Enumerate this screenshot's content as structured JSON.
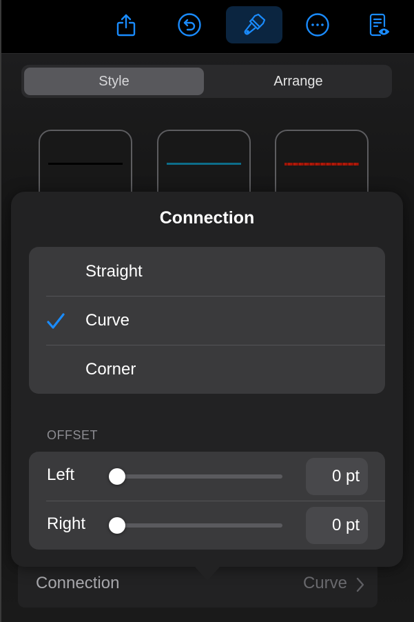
{
  "toolbar": {
    "buttons": [
      {
        "name": "share",
        "icon": "share-icon",
        "active": false
      },
      {
        "name": "undo",
        "icon": "undo-icon",
        "active": false
      },
      {
        "name": "format",
        "icon": "paintbrush-icon",
        "active": true
      },
      {
        "name": "more",
        "icon": "more-icon",
        "active": false
      },
      {
        "name": "reading-view",
        "icon": "document-eye-icon",
        "active": false
      }
    ],
    "accent_color": "#1a8cff"
  },
  "segmented": {
    "tabs": [
      {
        "label": "Style",
        "selected": true
      },
      {
        "label": "Arrange",
        "selected": false
      }
    ]
  },
  "line_styles": [
    {
      "name": "black-line",
      "color": "#000000"
    },
    {
      "name": "teal-line",
      "color": "#0d6d8a"
    },
    {
      "name": "red-textured-line",
      "color": "#a01508"
    }
  ],
  "popover": {
    "title": "Connection",
    "options": [
      {
        "label": "Straight",
        "selected": false
      },
      {
        "label": "Curve",
        "selected": true
      },
      {
        "label": "Corner",
        "selected": false
      }
    ],
    "offset_section_label": "OFFSET",
    "offsets": [
      {
        "label": "Left",
        "value": "0 pt",
        "slider_fraction": 0
      },
      {
        "label": "Right",
        "value": "0 pt",
        "slider_fraction": 0
      }
    ]
  },
  "bottom_row": {
    "label": "Connection",
    "value": "Curve"
  }
}
